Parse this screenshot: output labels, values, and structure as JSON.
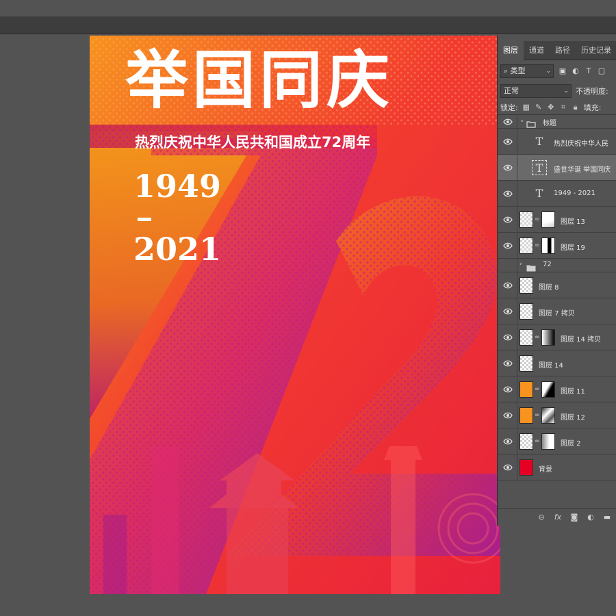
{
  "poster": {
    "title": "举国同庆",
    "subtitle": "热烈庆祝中华人民共和国成立72周年",
    "year_start": "1949",
    "year_end": "2021",
    "number": "72",
    "colors": {
      "red": "#f0213a",
      "orange": "#f7931e",
      "magenta": "#c2187a",
      "purple": "#7a1fa0"
    }
  },
  "layers_panel": {
    "tabs": [
      {
        "label": "图层",
        "active": true
      },
      {
        "label": "通道",
        "active": false
      },
      {
        "label": "路径",
        "active": false
      },
      {
        "label": "历史记录",
        "active": false
      }
    ],
    "filter": {
      "kind": "类型",
      "icons": [
        "image-filter-icon",
        "adjustment-filter-icon",
        "text-filter-icon"
      ]
    },
    "blend_mode": "正常",
    "opacity_label": "不透明度:",
    "lock_label": "锁定:",
    "fill_label": "填充:",
    "layers": [
      {
        "kind": "group",
        "name": "标题",
        "expanded": true
      },
      {
        "kind": "text",
        "name": "热烈庆祝中华人民",
        "selected": false
      },
      {
        "kind": "text",
        "name": "盛世华诞 举国同庆",
        "selected": true
      },
      {
        "kind": "text",
        "name": "1949 - 2021",
        "selected": false
      },
      {
        "kind": "masked",
        "name": "图层 13",
        "mask": "mask-13"
      },
      {
        "kind": "masked",
        "name": "图层 19",
        "mask": "mask-19"
      },
      {
        "kind": "group",
        "name": "72",
        "expanded": false
      },
      {
        "kind": "plain",
        "name": "图层 8"
      },
      {
        "kind": "plain",
        "name": "图层 7 拷贝"
      },
      {
        "kind": "masked",
        "name": "图层 14 拷贝",
        "mask": "mask-14c"
      },
      {
        "kind": "plain",
        "name": "图层 14"
      },
      {
        "kind": "masked",
        "name": "图层 11",
        "mask": "mask-11",
        "thumb": "orange"
      },
      {
        "kind": "masked",
        "name": "图层 12",
        "mask": "mask-12",
        "thumb": "orange"
      },
      {
        "kind": "masked",
        "name": "图层 2",
        "mask": "mask-2"
      },
      {
        "kind": "plain",
        "name": "背景",
        "thumb": "red"
      }
    ],
    "bottom_icons": [
      "link-icon",
      "fx-icon",
      "mask-icon",
      "adjustment-icon",
      "new-group-icon"
    ]
  }
}
